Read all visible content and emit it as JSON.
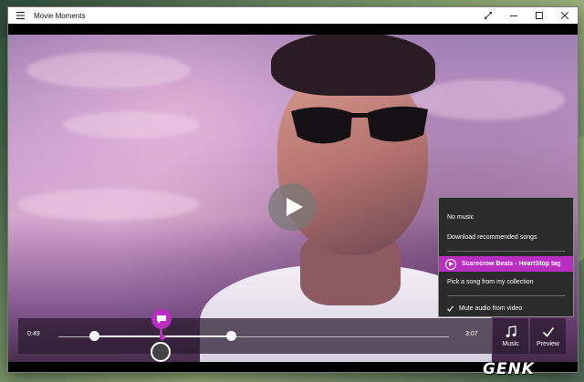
{
  "window": {
    "title": "Movie Moments"
  },
  "player": {
    "current_time": "0:49",
    "total_time": "3:07"
  },
  "music_menu": {
    "items": [
      {
        "label": "No music"
      },
      {
        "label": "Download recommended songs"
      },
      {
        "label": "Scarecrow Beats - HeartStop tag",
        "selected": true
      },
      {
        "label": "Pick a song from my collection"
      },
      {
        "label": "Mute audio from video",
        "checked": true
      }
    ]
  },
  "buttons": {
    "music_label": "Music",
    "preview_label": "Preview"
  },
  "watermark": "GENK",
  "colors": {
    "accent": "#b72ec1",
    "menu_bg": "#2b2b2b",
    "titlebar_bg": "#ffffff"
  },
  "icons": {
    "menu": "hamburger-icon",
    "expand": "expand-icon",
    "minimize": "minimize-icon",
    "maximize": "maximize-icon",
    "close": "close-icon",
    "play": "play-icon",
    "music": "music-note-icon",
    "preview": "checkmark-icon",
    "caption": "speech-bubble-icon"
  }
}
